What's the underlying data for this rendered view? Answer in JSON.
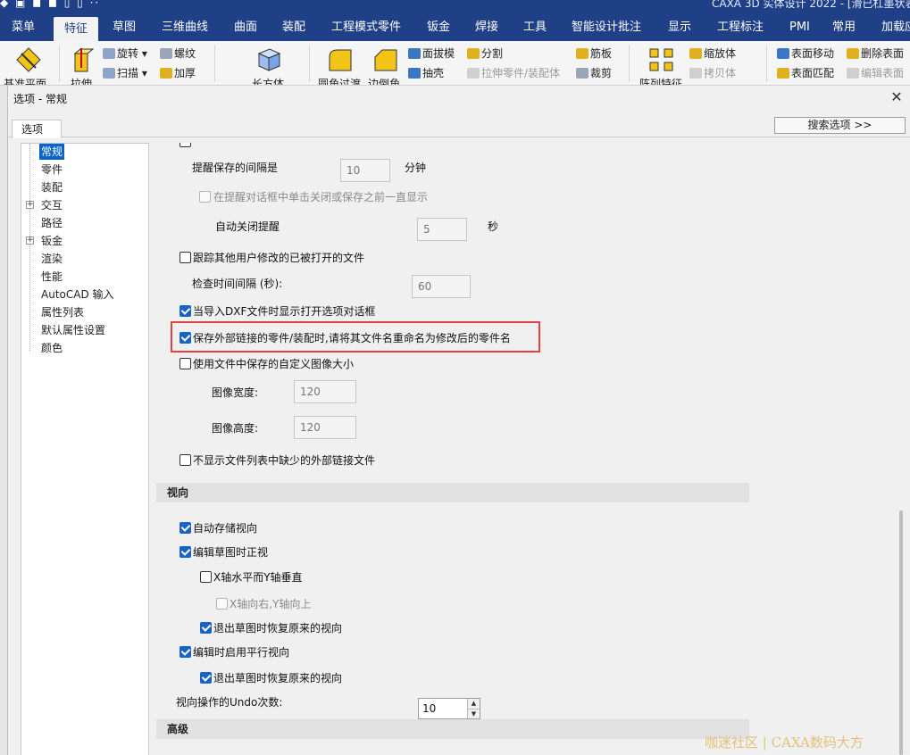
{
  "app": {
    "title": "CAXA 3D 实体设计 2022 - [滑已杠墨状表]"
  },
  "menubar": {
    "tabs": [
      "菜单",
      "特征",
      "草图",
      "三维曲线",
      "曲面",
      "装配",
      "工程模式零件",
      "钣金",
      "焊接",
      "工具",
      "智能设计批注",
      "显示",
      "工程标注",
      "PMI",
      "常用",
      "加载应"
    ],
    "active": "特征"
  },
  "ribbon": {
    "big": [
      "基准平面",
      "拉伸",
      "长方体",
      "圆角过渡",
      "边倒角",
      "阵列特征"
    ],
    "items": {
      "rotate": "旋转",
      "helix": "螺纹",
      "sweep": "扫描",
      "thicken": "加厚",
      "face_draft": "面拔模",
      "split": "分割",
      "shell": "抽壳",
      "extend_part": "拉伸零件/装配体",
      "rib": "筋板",
      "trim": "裁剪",
      "scale": "缩放体",
      "copy_body": "拷贝体",
      "face_move": "表面移动",
      "delete_face": "删除表面",
      "face_match": "表面匹配",
      "edit_face": "编辑表面"
    }
  },
  "dialog": {
    "title": "选项 - 常规",
    "close_glyph": "✕",
    "tab_label": "选项",
    "search_button": "搜索选项 >>",
    "tree": {
      "items": [
        "常规",
        "零件",
        "装配",
        "交互",
        "路径",
        "钣金",
        "渲染",
        "性能",
        "AutoCAD 输入",
        "属性列表",
        "默认属性设置",
        "颜色"
      ],
      "selected": "常规",
      "expandable": [
        "交互",
        "钣金"
      ]
    },
    "general": {
      "remind_interval_label": "提醒保存的间隔是",
      "remind_interval_value": "10",
      "remind_interval_unit": "分钟",
      "keep_prompt_label": "在提醒对话框中单击关闭或保存之前一直显示",
      "auto_close_label": "自动关闭提醒",
      "auto_close_value": "5",
      "auto_close_unit": "秒",
      "track_modified_label": "跟踪其他用户修改的已被打开的文件",
      "check_interval_label": "检查时间间隔 (秒):",
      "check_interval_value": "60",
      "dxf_dialog_label": "当导入DXF文件时显示打开选项对话框",
      "rename_linked_label": "保存外部链接的零件/装配时,请将其文件名重命名为修改后的零件名",
      "custom_image_size_label": "使用文件中保存的自定义图像大小",
      "image_width_label": "图像宽度:",
      "image_width_value": "120",
      "image_height_label": "图像高度:",
      "image_height_value": "120",
      "hide_missing_links_label": "不显示文件列表中缺少的外部链接文件"
    },
    "view_section": {
      "header": "视向",
      "auto_save_view": "自动存储视向",
      "sketch_normal_view": "编辑草图时正视",
      "x_horizontal_y_vertical": "X轴水平而Y轴垂直",
      "x_right_y_up": "X轴向右,Y轴向上",
      "restore_on_exit_1": "退出草图时恢复原来的视向",
      "parallel_view_on_edit": "编辑时启用平行视向",
      "restore_on_exit_2": "退出草图时恢复原来的视向",
      "undo_count_label": "视向操作的Undo次数:",
      "undo_count_value": "10"
    },
    "advanced_section": {
      "header": "高级"
    }
  },
  "watermark": "咖迷社区 | CAXA数码大方",
  "colors": {
    "menubar_bg": "#1f3f86",
    "checkbox_checked": "#1a62c6",
    "tree_selected": "#0a64c8",
    "highlight_box": "#e24242"
  }
}
